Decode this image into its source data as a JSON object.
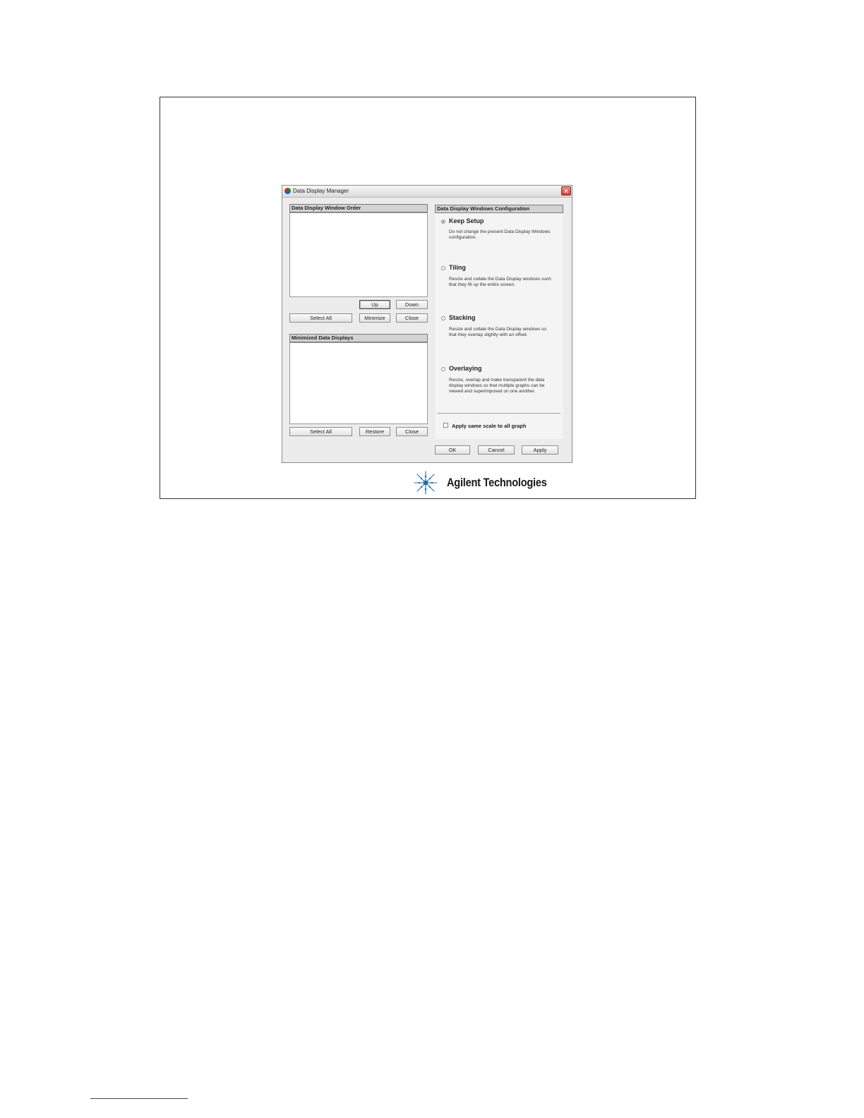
{
  "dialog": {
    "title": "Data Display Manager",
    "close_label": "✕"
  },
  "window_order": {
    "header": "Data Display Window Order",
    "buttons": {
      "up": "Up",
      "down": "Down",
      "select_all": "Select All",
      "minimize": "Minimize",
      "close": "Close"
    }
  },
  "minimized": {
    "header": "Minimized Data Displays",
    "buttons": {
      "select_all": "Select All",
      "restore": "Restore",
      "close": "Close"
    }
  },
  "configuration": {
    "header": "Data Display Windows Configuration",
    "options": [
      {
        "title": "Keep Setup",
        "desc": "Do not change the present Data Display Windows configuration.",
        "checked": true
      },
      {
        "title": "Tiling",
        "desc": "Resize and collate the Data Display windows such that they fill up the entire screen.",
        "checked": false
      },
      {
        "title": "Stacking",
        "desc": "Resize and collate the Data Display windows so that they overlap slightly with an offset.",
        "checked": false
      },
      {
        "title": "Overlaying",
        "desc": "Resize, overlap and make transparent the data display windows so that multiple graphs can be viewed and superimposed on one another.",
        "checked": false
      }
    ],
    "apply_same_scale_label": "Apply same scale to all graph",
    "apply_same_scale_checked": false
  },
  "footer_buttons": {
    "ok": "OK",
    "cancel": "Cancel",
    "apply": "Apply"
  },
  "branding": {
    "company": "Agilent Technologies",
    "logo_icon": "agilent-spark-icon"
  }
}
